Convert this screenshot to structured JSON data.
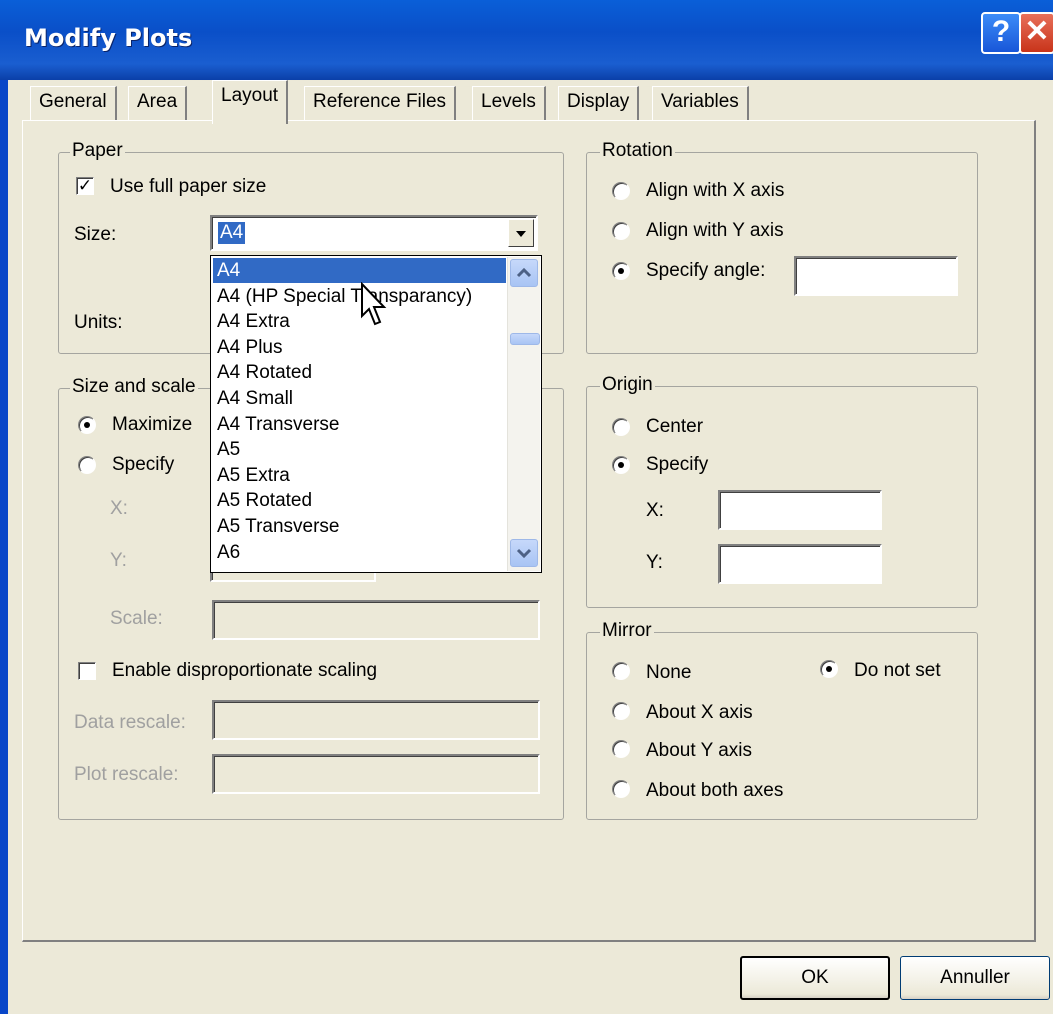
{
  "window": {
    "title": "Modify Plots",
    "help_glyph": "?",
    "close_glyph": "✕"
  },
  "tabs": [
    {
      "label": "General"
    },
    {
      "label": "Area"
    },
    {
      "label": "Layout"
    },
    {
      "label": "Reference Files"
    },
    {
      "label": "Levels"
    },
    {
      "label": "Display"
    },
    {
      "label": "Variables"
    }
  ],
  "paper": {
    "title": "Paper",
    "use_full_label": "Use full paper size",
    "use_full_checked": "✓",
    "size_label": "Size:",
    "size_value": "A4",
    "units_label": "Units:",
    "options": [
      "A4",
      "A4 (HP Special Transparancy)",
      "A4 Extra",
      "A4 Plus",
      "A4 Rotated",
      "A4 Small",
      "A4 Transverse",
      "A5",
      "A5 Extra",
      "A5 Rotated",
      "A5 Transverse",
      "A6"
    ]
  },
  "size_scale": {
    "title": "Size and scale",
    "maximize_label": "Maximize",
    "specify_label": "Specify",
    "x_label": "X:",
    "y_label": "Y:",
    "scale_label": "Scale:",
    "disproportionate_label": "Enable disproportionate scaling",
    "data_rescale_label": "Data rescale:",
    "plot_rescale_label": "Plot rescale:"
  },
  "rotation": {
    "title": "Rotation",
    "align_x_label": "Align with X axis",
    "align_y_label": "Align with Y axis",
    "specify_angle_label": "Specify angle:"
  },
  "origin": {
    "title": "Origin",
    "center_label": "Center",
    "specify_label": "Specify",
    "x_label": "X:",
    "y_label": "Y:"
  },
  "mirror": {
    "title": "Mirror",
    "none_label": "None",
    "do_not_set_label": "Do not set",
    "about_x_label": "About X axis",
    "about_y_label": "About Y axis",
    "about_both_label": "About both axes"
  },
  "buttons": {
    "ok_label": "OK",
    "cancel_label": "Annuller"
  },
  "colors": {
    "title_bar": "#0a4fc8",
    "selection": "#316ac5",
    "dialog_bg": "#ece9d8"
  }
}
